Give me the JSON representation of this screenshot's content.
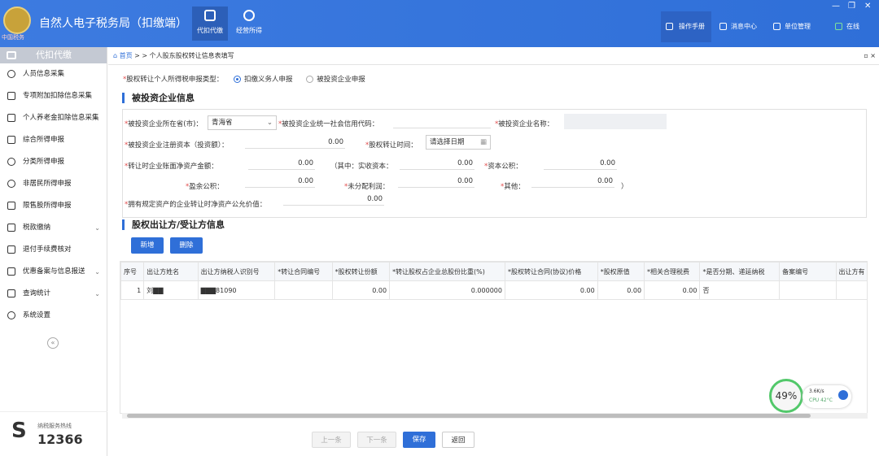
{
  "app": {
    "title": "自然人电子税务局（扣缴端）",
    "emblem_text": "中国税务"
  },
  "nav_tabs": [
    {
      "label": "代扣代缴"
    },
    {
      "label": "经营所得"
    }
  ],
  "header_right": [
    {
      "label": "操作手册"
    },
    {
      "label": "消息中心"
    },
    {
      "label": "单位管理"
    },
    {
      "label": "在线"
    }
  ],
  "window_controls": {
    "minimize": "—",
    "restore": "❐",
    "close": "✕"
  },
  "sidebar": {
    "title": "代扣代缴",
    "items": [
      {
        "label": "人员信息采集"
      },
      {
        "label": "专项附加扣除信息采集"
      },
      {
        "label": "个人养老金扣除信息采集"
      },
      {
        "label": "综合所得申报"
      },
      {
        "label": "分类所得申报"
      },
      {
        "label": "非居民所得申报"
      },
      {
        "label": "限售股所得申报"
      },
      {
        "label": "税款缴纳"
      },
      {
        "label": "退付手续费核对"
      },
      {
        "label": "优惠备案与信息报送"
      },
      {
        "label": "查询统计"
      },
      {
        "label": "系统设置"
      }
    ],
    "collapse": "«",
    "hotline_label": "纳税服务热线",
    "hotline_number": "12366"
  },
  "breadcrumb": {
    "home": "首页",
    "sep": " > > ",
    "current": "个人股东股权转让信息表填写",
    "pin": "▫ ×"
  },
  "report_type": {
    "label": "股权转让个人所得税申报类型：",
    "options": [
      "扣缴义务人申报",
      "被投资企业申报"
    ],
    "selected": 0
  },
  "sections": {
    "invested": "被投资企业信息",
    "transfer": "股权出让方/受让方信息"
  },
  "form": {
    "province_label": "被投资企业所在省(市)：",
    "province_value": "青海省",
    "credit_code_label": "被投资企业统一社会信用代码：",
    "name_label": "被投资企业名称：",
    "capital_label": "被投资企业注册资本（投资额）：",
    "capital_value": "0.00",
    "transfer_time_label": "股权转让时间：",
    "transfer_time_placeholder": "请选择日期",
    "net_asset_label": "转让时企业账面净资产金额：",
    "net_asset_value": "0.00",
    "paid_in_label": "（其中：实收资本：",
    "paid_in_value": "0.00",
    "capital_reserve_label": "资本公积：",
    "capital_reserve_value": "0.00",
    "surplus_label": "盈余公积：",
    "surplus_value": "0.00",
    "undistributed_label": "未分配利润：",
    "undistributed_value": "0.00",
    "other_label": "其他：",
    "other_value": "0.00",
    "close_paren": "）",
    "fair_value_label": "拥有规定资产的企业转让时净资产公允价值：",
    "fair_value_value": "0.00"
  },
  "buttons": {
    "add": "新增",
    "delete": "删除",
    "prev": "上一条",
    "next": "下一条",
    "save": "保存",
    "back": "返回"
  },
  "table": {
    "headers": [
      "序号",
      "出让方姓名",
      "出让方纳税人识别号",
      "*转让合同编号",
      "*股权转让份额",
      "*转让股权占企业总股份比重(%)",
      "*股权转让合同(协议)价格",
      "*股权原值",
      "*相关合理税费",
      "*是否分期、递延纳税",
      "备案编号",
      "出让方有"
    ],
    "rows": [
      [
        "1",
        "刘▇▇",
        "▇▇▇81090",
        "",
        "0.00",
        "0.000000",
        "0.00",
        "0.00",
        "0.00",
        "否",
        "",
        ""
      ]
    ]
  },
  "monitor": {
    "percent": "49%",
    "speed": "3.6K/s",
    "cpu": "CPU 42°C"
  }
}
